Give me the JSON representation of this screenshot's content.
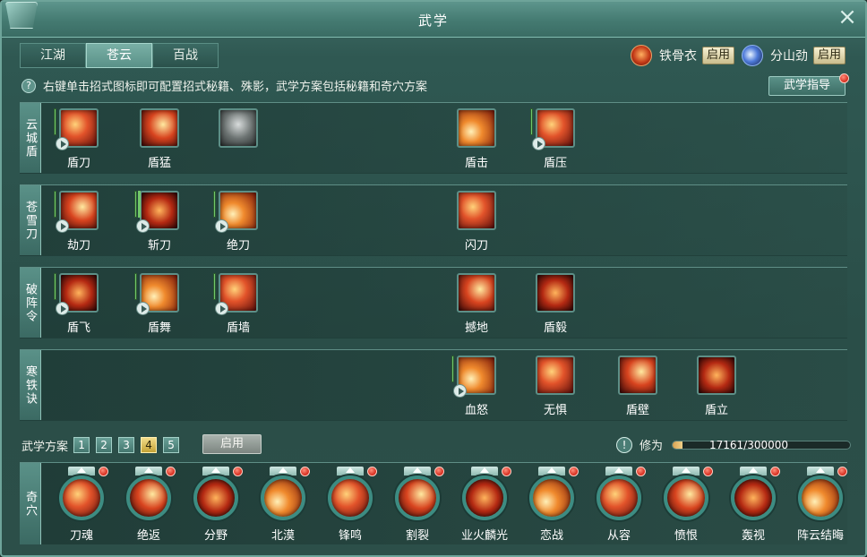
{
  "window": {
    "title": "武学"
  },
  "tabs": [
    {
      "label": "江湖",
      "active": false
    },
    {
      "label": "苍云",
      "active": true
    },
    {
      "label": "百战",
      "active": false
    }
  ],
  "stances": [
    {
      "name": "铁骨衣",
      "button": "启用",
      "icon": "iron-bone-stance-icon"
    },
    {
      "name": "分山劲",
      "button": "启用",
      "icon": "split-mountain-stance-icon"
    }
  ],
  "hint": {
    "text": "右键单击招式图标即可配置招式秘籍、殊影，武学方案包括秘籍和奇穴方案"
  },
  "guide_button": "武学指导",
  "rows": [
    {
      "label": "云城盾",
      "skills": [
        {
          "name": "盾刀",
          "col": 0,
          "bars": 1,
          "play": true
        },
        {
          "name": "盾猛",
          "col": 1,
          "bars": 0,
          "play": false
        },
        {
          "name": "",
          "col": 2,
          "bars": 0,
          "play": false,
          "locked": true
        },
        {
          "name": "盾击",
          "col": 5,
          "bars": 0,
          "play": false
        },
        {
          "name": "盾压",
          "col": 6,
          "bars": 1,
          "play": true
        }
      ]
    },
    {
      "label": "苍雪刀",
      "skills": [
        {
          "name": "劫刀",
          "col": 0,
          "bars": 1,
          "play": true
        },
        {
          "name": "斩刀",
          "col": 1,
          "bars": 2,
          "play": true
        },
        {
          "name": "绝刀",
          "col": 2,
          "bars": 1,
          "play": true
        },
        {
          "name": "闪刀",
          "col": 5,
          "bars": 0,
          "play": false
        }
      ]
    },
    {
      "label": "破阵令",
      "skills": [
        {
          "name": "盾飞",
          "col": 0,
          "bars": 1,
          "play": true
        },
        {
          "name": "盾舞",
          "col": 1,
          "bars": 1,
          "play": true
        },
        {
          "name": "盾墙",
          "col": 2,
          "bars": 1,
          "play": true
        },
        {
          "name": "撼地",
          "col": 5,
          "bars": 0,
          "play": false
        },
        {
          "name": "盾毅",
          "col": 6,
          "bars": 0,
          "play": false
        }
      ]
    },
    {
      "label": "寒铁诀",
      "skills": [
        {
          "name": "血怒",
          "col": 5,
          "bars": 1,
          "play": true
        },
        {
          "name": "无惧",
          "col": 6,
          "bars": 0,
          "play": false
        },
        {
          "name": "盾壁",
          "col": 7,
          "bars": 0,
          "play": false
        },
        {
          "name": "盾立",
          "col": 8,
          "bars": 0,
          "play": false
        }
      ]
    }
  ],
  "scheme": {
    "label": "武学方案",
    "numbers": [
      "1",
      "2",
      "3",
      "4",
      "5"
    ],
    "active_index": 3,
    "apply_button": "启用"
  },
  "cultivation": {
    "label": "修为",
    "value_text": "17161/300000",
    "progress": 0.0572
  },
  "qixue": {
    "label": "奇穴",
    "items": [
      "刀魂",
      "绝返",
      "分野",
      "北漠",
      "锋鸣",
      "割裂",
      "业火麟光",
      "恋战",
      "从容",
      "愤恨",
      "轰视",
      "阵云结晦"
    ]
  },
  "colors": {
    "accent": "#5a9188",
    "frame": "#6ea49a",
    "progress": "#d8a454",
    "notification": "#d4291b"
  }
}
